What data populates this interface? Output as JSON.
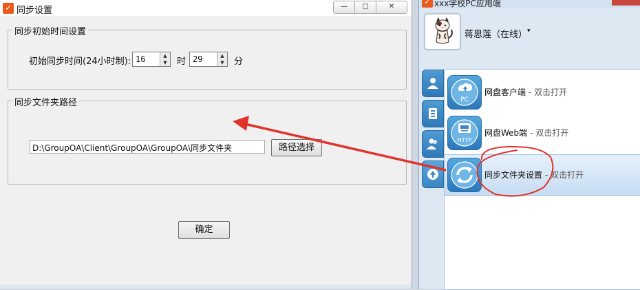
{
  "dialog": {
    "title": "同步设置",
    "logo": "✓",
    "window_buttons": [
      "—",
      "▢",
      "✕"
    ],
    "group_start": {
      "legend": "同步初始时间设置",
      "time_label": "初始同步时间(24小时制):",
      "hour_value": "16",
      "hour_unit": "时",
      "minute_value": "29",
      "minute_unit": "分"
    },
    "group_path": {
      "legend": "同步文件夹路径",
      "path_value": "D:\\GroupOA\\Client\\GroupOA\\GroupOA\\同步文件夹",
      "browse_button": "路径选择"
    },
    "ok_button": "确定"
  },
  "panel": {
    "title": "xxx学校PC应用端",
    "user": {
      "name": "蒋思莲（在线）",
      "caret": "▾"
    },
    "side_tabs": [
      "person-icon",
      "contacts-icon",
      "group-icon",
      "apps-icon"
    ],
    "items": [
      {
        "name": "网盘客户端",
        "hint": "- 双击打开",
        "icon": "cloud-pc-icon",
        "icon_text": "PC"
      },
      {
        "name": "网盘Web端",
        "hint": "- 双击打开",
        "icon": "http-icon",
        "icon_text": "HTTP"
      },
      {
        "name": "同步文件夹设置",
        "hint": "- 双击打开",
        "icon": "sync-icon",
        "selected": true
      }
    ]
  },
  "colors": {
    "accent_blue": "#2b78bb",
    "annotation_red": "#e0332b",
    "logo_orange": "#ea5a1b"
  }
}
